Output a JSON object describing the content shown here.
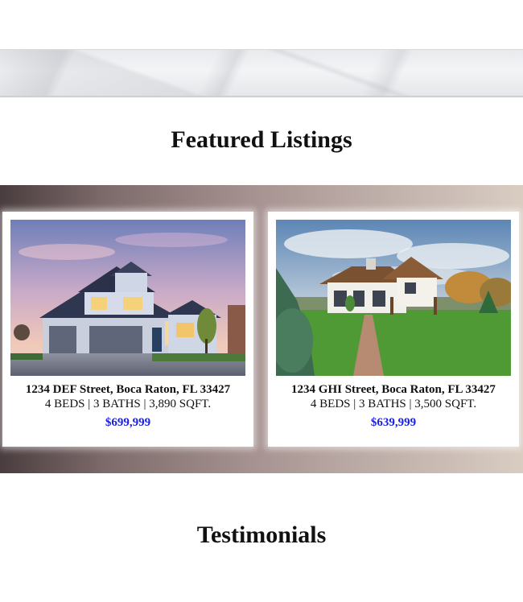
{
  "sections": {
    "featured_title": "Featured Listings",
    "testimonials_title": "Testimonials"
  },
  "listings": [
    {
      "address": "1234 DEF Street, Boca Raton, FL 33427",
      "specs": "4 BEDS | 3 BATHS | 3,890 SQFT.",
      "price": "$699,999",
      "photo_icon": "house-photo-dusk"
    },
    {
      "address": "1234 GHI Street, Boca Raton, FL 33427",
      "specs": "4 BEDS | 3 BATHS | 3,500 SQFT.",
      "price": "$639,999",
      "photo_icon": "house-photo-lawn"
    }
  ],
  "colors": {
    "price": "#1a22e0",
    "band_dark": "#4a3d3f",
    "band_light": "#d9cdc2"
  }
}
